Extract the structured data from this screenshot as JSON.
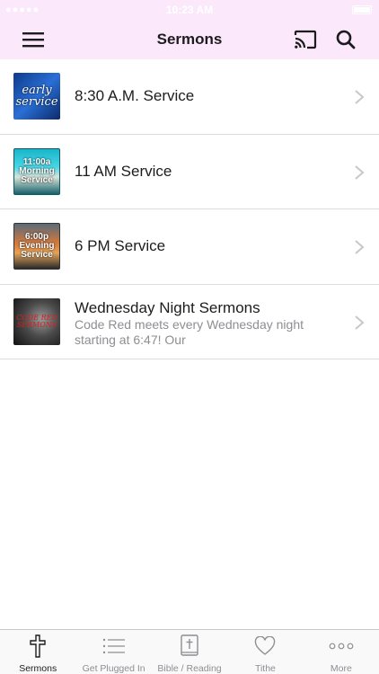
{
  "status_bar": {
    "carrier": "●●●●● ",
    "time": "10:23 AM"
  },
  "nav": {
    "title": "Sermons",
    "icons": [
      "hamburger-menu-icon",
      "cast-icon",
      "search-icon"
    ]
  },
  "sermons": [
    {
      "title": "8:30 A.M. Service",
      "subtitle": "",
      "thumb_text": "early service",
      "thumb_icon": "early-service-artwork"
    },
    {
      "title": "11 AM Service",
      "subtitle": "",
      "thumb_text": "11:00a Morning Service",
      "thumb_icon": "morning-service-artwork"
    },
    {
      "title": "6 PM Service",
      "subtitle": "",
      "thumb_text": "6:00p Evening Service",
      "thumb_icon": "evening-service-artwork"
    },
    {
      "title": "Wednesday Night Sermons",
      "subtitle": "Code Red meets every Wednesday night starting at 6:47!  Our",
      "thumb_text": "CODE RED SERMONS",
      "thumb_icon": "code-red-artwork"
    }
  ],
  "tabs": [
    {
      "label": "Sermons",
      "icon": "cross-icon",
      "active": true
    },
    {
      "label": "Get Plugged In",
      "icon": "list-icon",
      "active": false
    },
    {
      "label": "Bible / Reading",
      "icon": "bible-icon",
      "active": false
    },
    {
      "label": "Tithe",
      "icon": "heart-icon",
      "active": false
    },
    {
      "label": "More",
      "icon": "more-dots-icon",
      "active": false
    }
  ],
  "colors": {
    "nav_background": "#fbe9fb",
    "separator": "#dcdcdc",
    "subtitle": "#8e8e93",
    "tab_inactive": "#8e8e93",
    "tab_active": "#1c1c1e"
  }
}
